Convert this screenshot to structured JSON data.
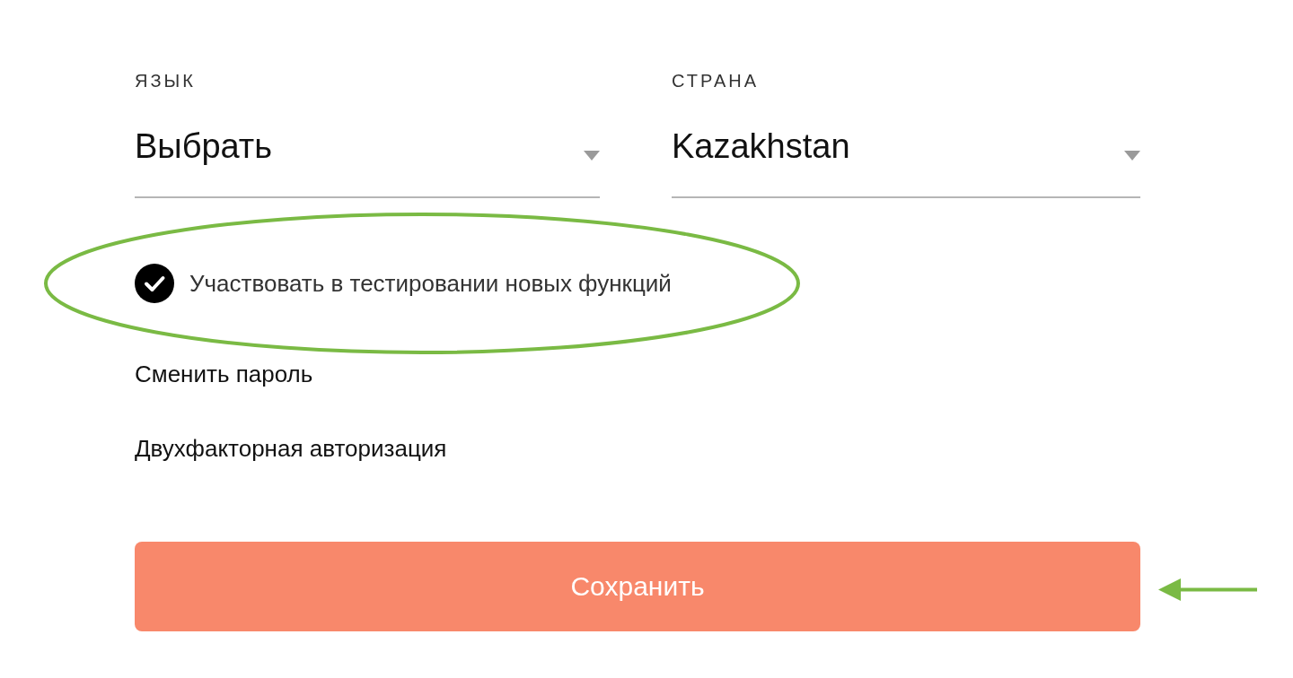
{
  "fields": [
    {
      "label": "ЯЗЫК",
      "value": "Выбрать"
    },
    {
      "label": "СТРАНА",
      "value": "Kazakhstan"
    }
  ],
  "beta_option": {
    "label": "Участвовать в тестировании новых функций",
    "checked": true
  },
  "links": [
    "Сменить пароль",
    "Двухфакторная авторизация"
  ],
  "save_button": {
    "label": "Сохранить"
  }
}
